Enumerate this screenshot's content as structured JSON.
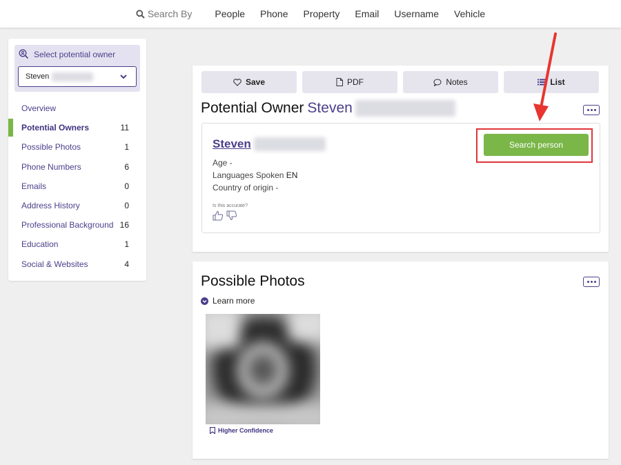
{
  "topnav": {
    "search_by": "Search By",
    "links": [
      "People",
      "Phone",
      "Property",
      "Email",
      "Username",
      "Vehicle"
    ]
  },
  "sidebar": {
    "select_label": "Select potential owner",
    "selected_owner": "Steven",
    "items": [
      {
        "label": "Overview",
        "count": ""
      },
      {
        "label": "Potential Owners",
        "count": "11"
      },
      {
        "label": "Possible Photos",
        "count": "1"
      },
      {
        "label": "Phone Numbers",
        "count": "6"
      },
      {
        "label": "Emails",
        "count": "0"
      },
      {
        "label": "Address History",
        "count": "0"
      },
      {
        "label": "Professional Background",
        "count": "16"
      },
      {
        "label": "Education",
        "count": "1"
      },
      {
        "label": "Social & Websites",
        "count": "4"
      }
    ],
    "active_index": 1
  },
  "actions": {
    "save": "Save",
    "pdf": "PDF",
    "notes": "Notes",
    "list": "List"
  },
  "owner_card": {
    "title_prefix": "Potential Owner",
    "title_name": "Steven",
    "person_name": "Steven",
    "age_label": "Age -",
    "languages_label": "Languages Spoken",
    "languages_value": "EN",
    "country_label": "Country of origin -",
    "accurate_prompt": "Is this accurate?",
    "search_button": "Search person"
  },
  "photos_card": {
    "title": "Possible Photos",
    "learn_more": "Learn more",
    "confidence": "Higher Confidence"
  },
  "colors": {
    "brand_purple": "#4a3f8a",
    "accent_green": "#7ab648",
    "annotation_red": "#e0343a"
  }
}
